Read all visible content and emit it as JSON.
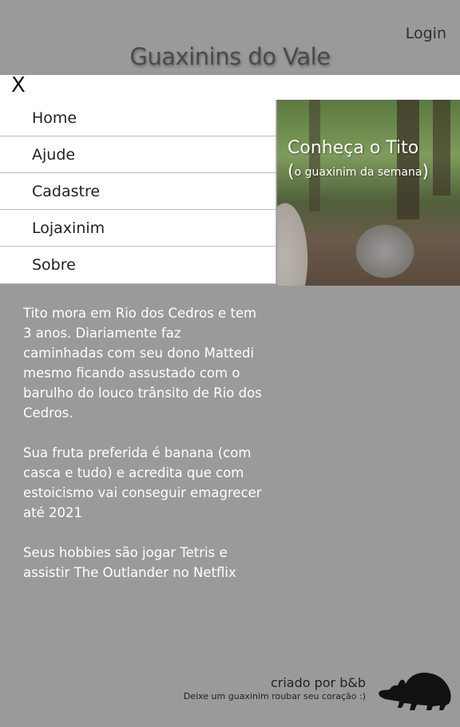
{
  "header": {
    "login_label": "Login",
    "site_title": "Guaxinins do Vale"
  },
  "menu": {
    "close_label": "X",
    "items": [
      {
        "label": "Home"
      },
      {
        "label": "Ajude"
      },
      {
        "label": "Cadastre"
      },
      {
        "label": "Lojaxinim"
      },
      {
        "label": "Sobre"
      }
    ]
  },
  "hero": {
    "title": "Conheça o Tito",
    "subtitle_open": "(",
    "subtitle": "o guaxinim da semana",
    "subtitle_close": ")"
  },
  "content": {
    "paragraphs": [
      "Tito mora em Rio dos Cedros e tem 3 anos. Diariamente faz caminhadas com seu dono Mattedi mesmo ficando assustado com o barulho do louco trânsito de Rio dos Cedros.",
      "Sua fruta preferida é banana (com casca e tudo) e acredita que com estoicismo vai conseguir emagrecer até 2021",
      "Seus hobbies são  jogar Tetris e assistir The Outlander no Netflix"
    ]
  },
  "footer": {
    "credit": "criado por b&b",
    "tagline": "Deixe um guaxinim roubar seu coração :)"
  },
  "colors": {
    "background": "#9a9a9c",
    "nav_background": "#ffffff",
    "text_light": "#ffffff"
  },
  "icons": {
    "close": "close-icon",
    "logo": "raccoon-silhouette-icon"
  }
}
